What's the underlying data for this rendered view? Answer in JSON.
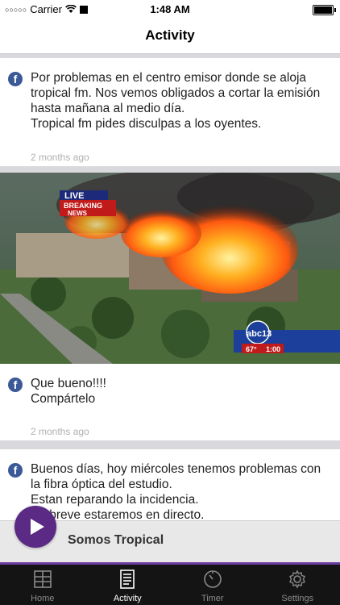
{
  "status_bar": {
    "signal": "○○○○○",
    "carrier": "Carrier",
    "time": "1:48 AM"
  },
  "navbar": {
    "title": "Activity"
  },
  "posts": [
    {
      "source_icon": "facebook-icon",
      "text": "Por problemas en el centro emisor donde se aloja tropical fm. Nos vemos obligados a cortar la emisión hasta mañana al medio día.\nTropical fm pides disculpas a los oyentes.",
      "time_ago": "2 months ago"
    },
    {
      "source_icon": "facebook-icon",
      "image": {
        "overlay_live": "LIVE",
        "overlay_breaking": "BREAKING",
        "overlay_news": "NEWS",
        "overlay_channel": "abc13",
        "overlay_temp": "67°",
        "overlay_clock": "1:00"
      },
      "text": "Que bueno!!!!\nCompártelo",
      "time_ago": "2 months ago"
    },
    {
      "source_icon": "facebook-icon",
      "text": "Buenos días, hoy miércoles tenemos problemas con la fibra óptica del estudio.\nEstan reparando la incidencia.\nEn breve estaremos en directo."
    }
  ],
  "player": {
    "station_name": "Somos Tropical",
    "play_icon": "play-icon"
  },
  "tabs": [
    {
      "label": "Home",
      "icon": "grid-icon",
      "active": false
    },
    {
      "label": "Activity",
      "icon": "document-icon",
      "active": true
    },
    {
      "label": "Timer",
      "icon": "timer-icon",
      "active": false
    },
    {
      "label": "Settings",
      "icon": "gear-icon",
      "active": false
    }
  ],
  "colors": {
    "accent": "#5a2a84",
    "facebook": "#3b5998",
    "tabbar": "#141414"
  }
}
